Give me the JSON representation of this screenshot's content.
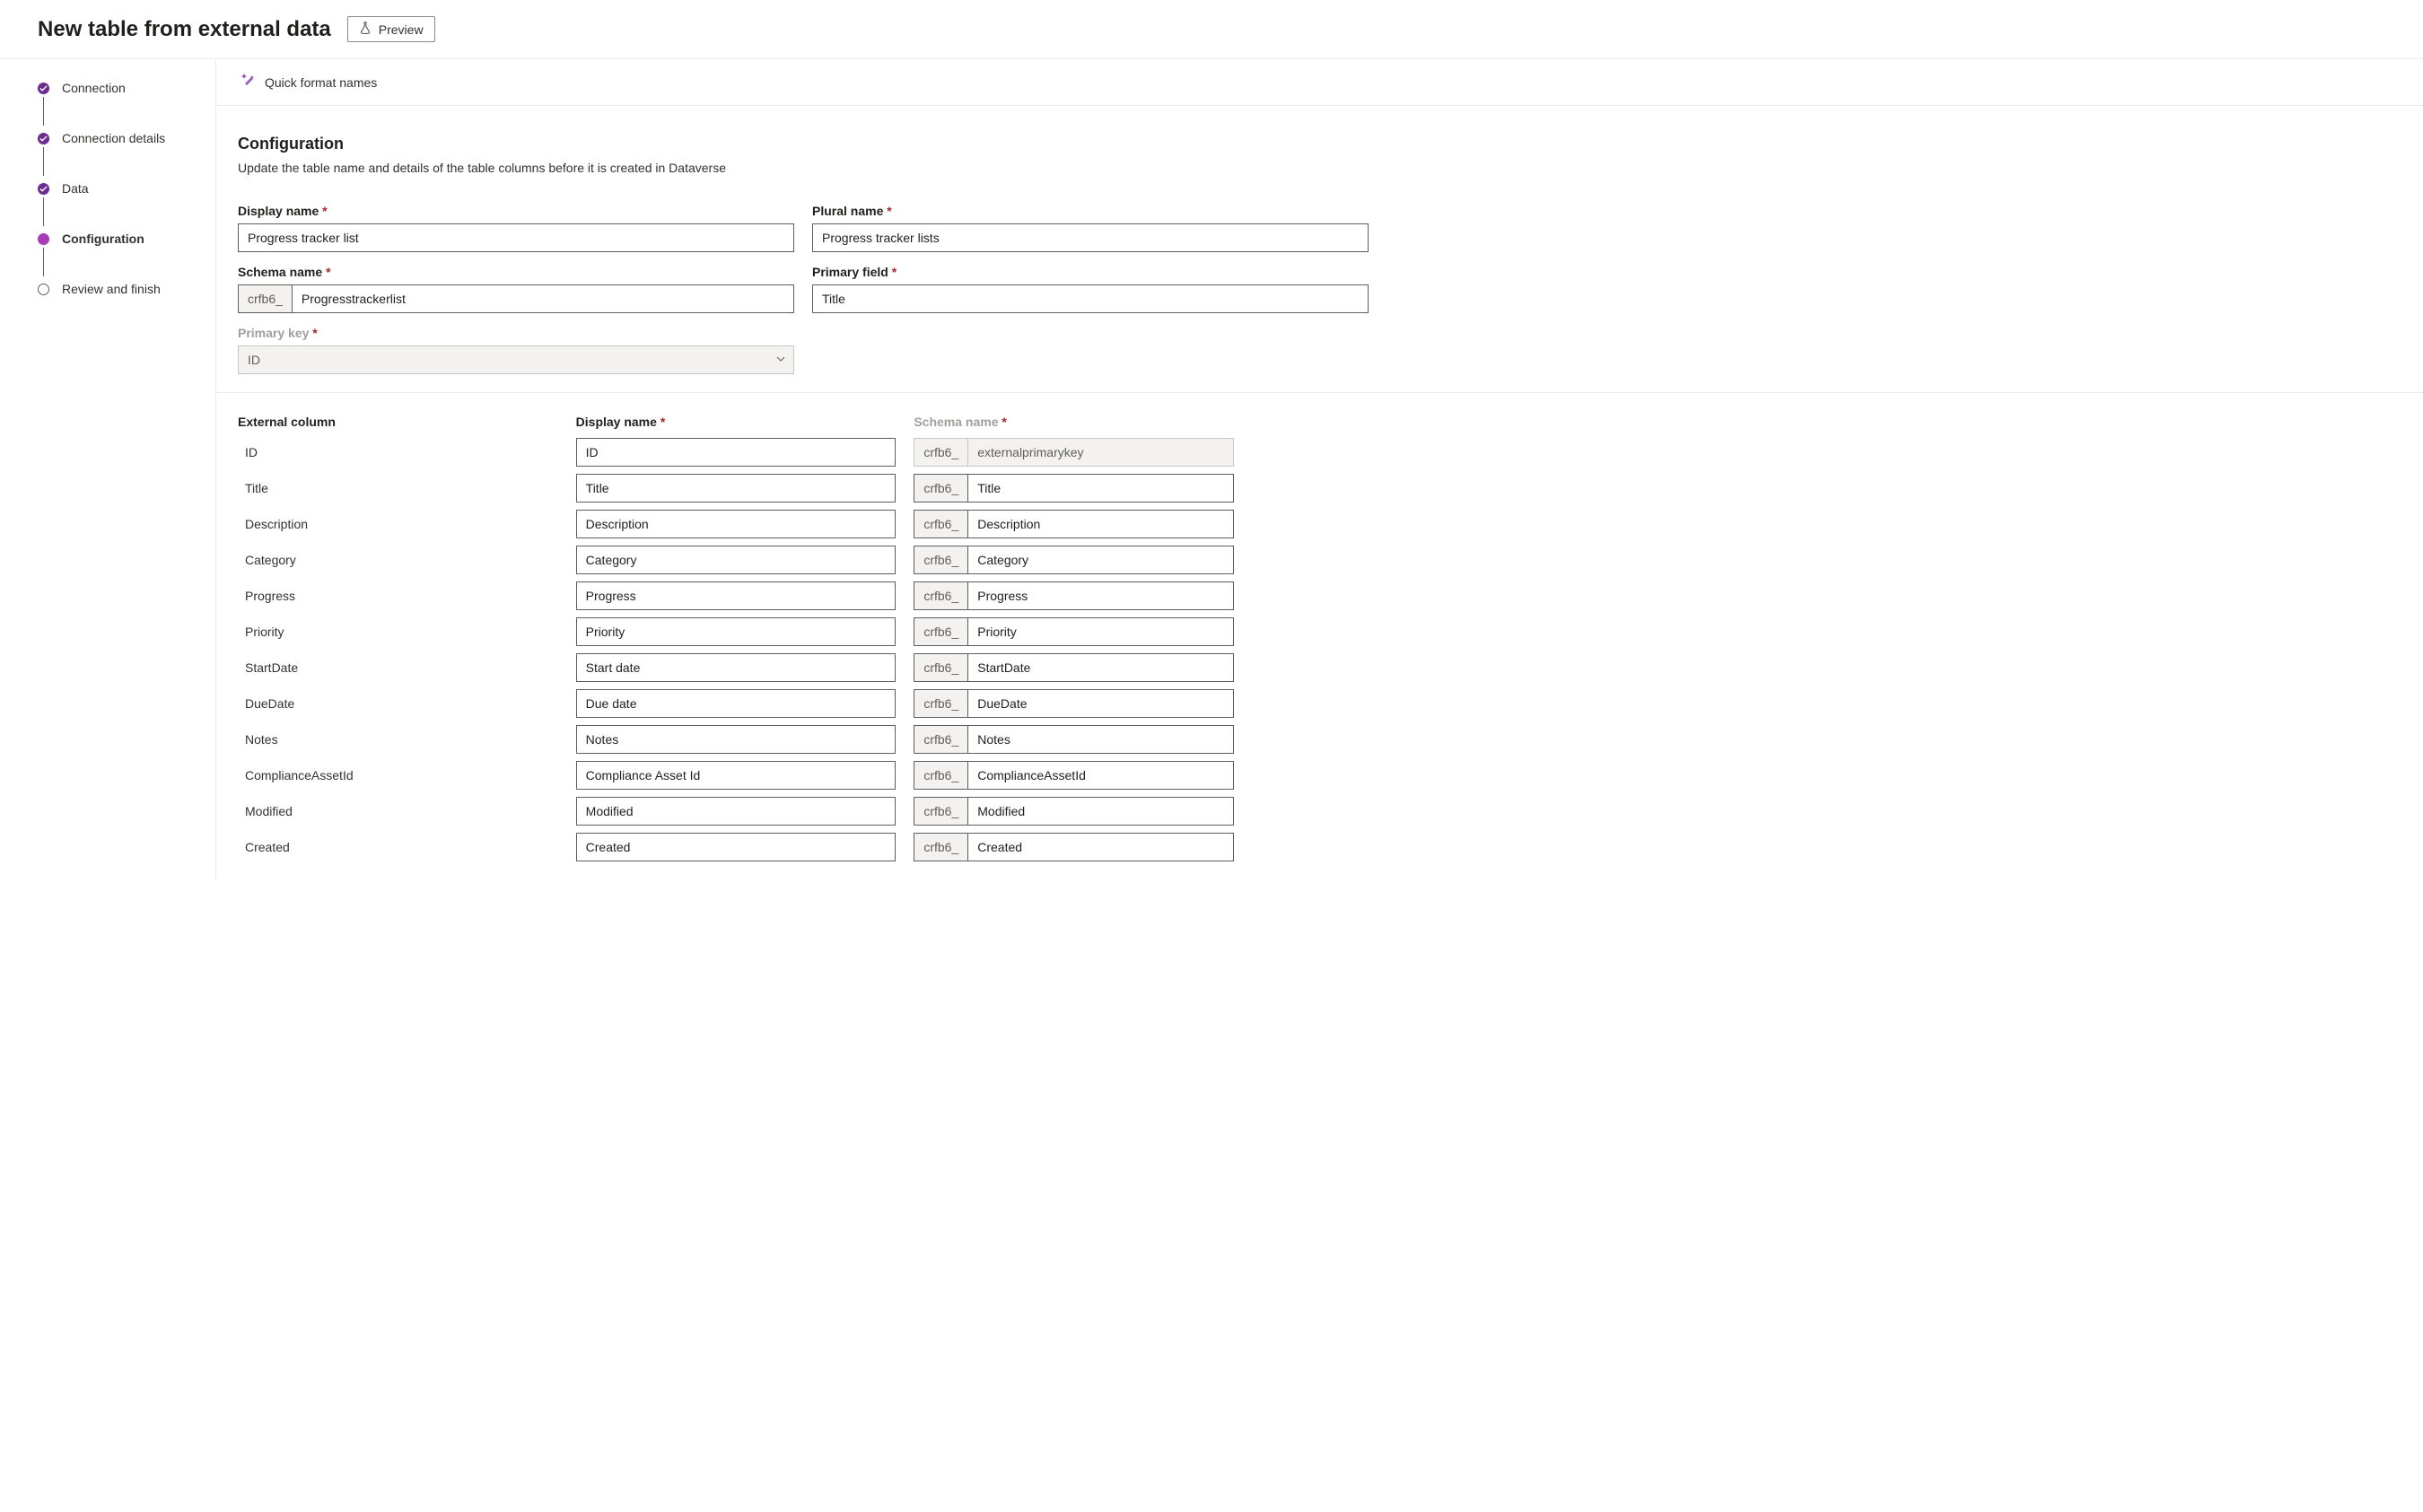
{
  "header": {
    "title": "New table from external data",
    "preview_label": "Preview"
  },
  "sidebar": {
    "steps": [
      {
        "label": "Connection",
        "state": "done"
      },
      {
        "label": "Connection details",
        "state": "done"
      },
      {
        "label": "Data",
        "state": "done"
      },
      {
        "label": "Configuration",
        "state": "current"
      },
      {
        "label": "Review and finish",
        "state": "upcoming"
      }
    ]
  },
  "toolbar": {
    "quick_format_label": "Quick format names"
  },
  "configuration": {
    "title": "Configuration",
    "description": "Update the table name and details of the table columns before it is created in Dataverse",
    "display_name_label": "Display name",
    "display_name_value": "Progress tracker list",
    "plural_name_label": "Plural name",
    "plural_name_value": "Progress tracker lists",
    "schema_name_label": "Schema name",
    "schema_prefix": "crfb6_",
    "schema_name_value": "Progresstrackerlist",
    "primary_field_label": "Primary field",
    "primary_field_value": "Title",
    "primary_key_label": "Primary key",
    "primary_key_value": "ID"
  },
  "columns": {
    "external_header": "External column",
    "display_header": "Display name",
    "schema_header": "Schema name",
    "schema_prefix": "crfb6_",
    "rows": [
      {
        "external": "ID",
        "display": "ID",
        "schema": "externalprimarykey",
        "schema_disabled": true
      },
      {
        "external": "Title",
        "display": "Title",
        "schema": "Title"
      },
      {
        "external": "Description",
        "display": "Description",
        "schema": "Description"
      },
      {
        "external": "Category",
        "display": "Category",
        "schema": "Category"
      },
      {
        "external": "Progress",
        "display": "Progress",
        "schema": "Progress"
      },
      {
        "external": "Priority",
        "display": "Priority",
        "schema": "Priority"
      },
      {
        "external": "StartDate",
        "display": "Start date",
        "schema": "StartDate"
      },
      {
        "external": "DueDate",
        "display": "Due date",
        "schema": "DueDate"
      },
      {
        "external": "Notes",
        "display": "Notes",
        "schema": "Notes"
      },
      {
        "external": "ComplianceAssetId",
        "display": "Compliance Asset Id",
        "schema": "ComplianceAssetId"
      },
      {
        "external": "Modified",
        "display": "Modified",
        "schema": "Modified"
      },
      {
        "external": "Created",
        "display": "Created",
        "schema": "Created"
      }
    ]
  }
}
